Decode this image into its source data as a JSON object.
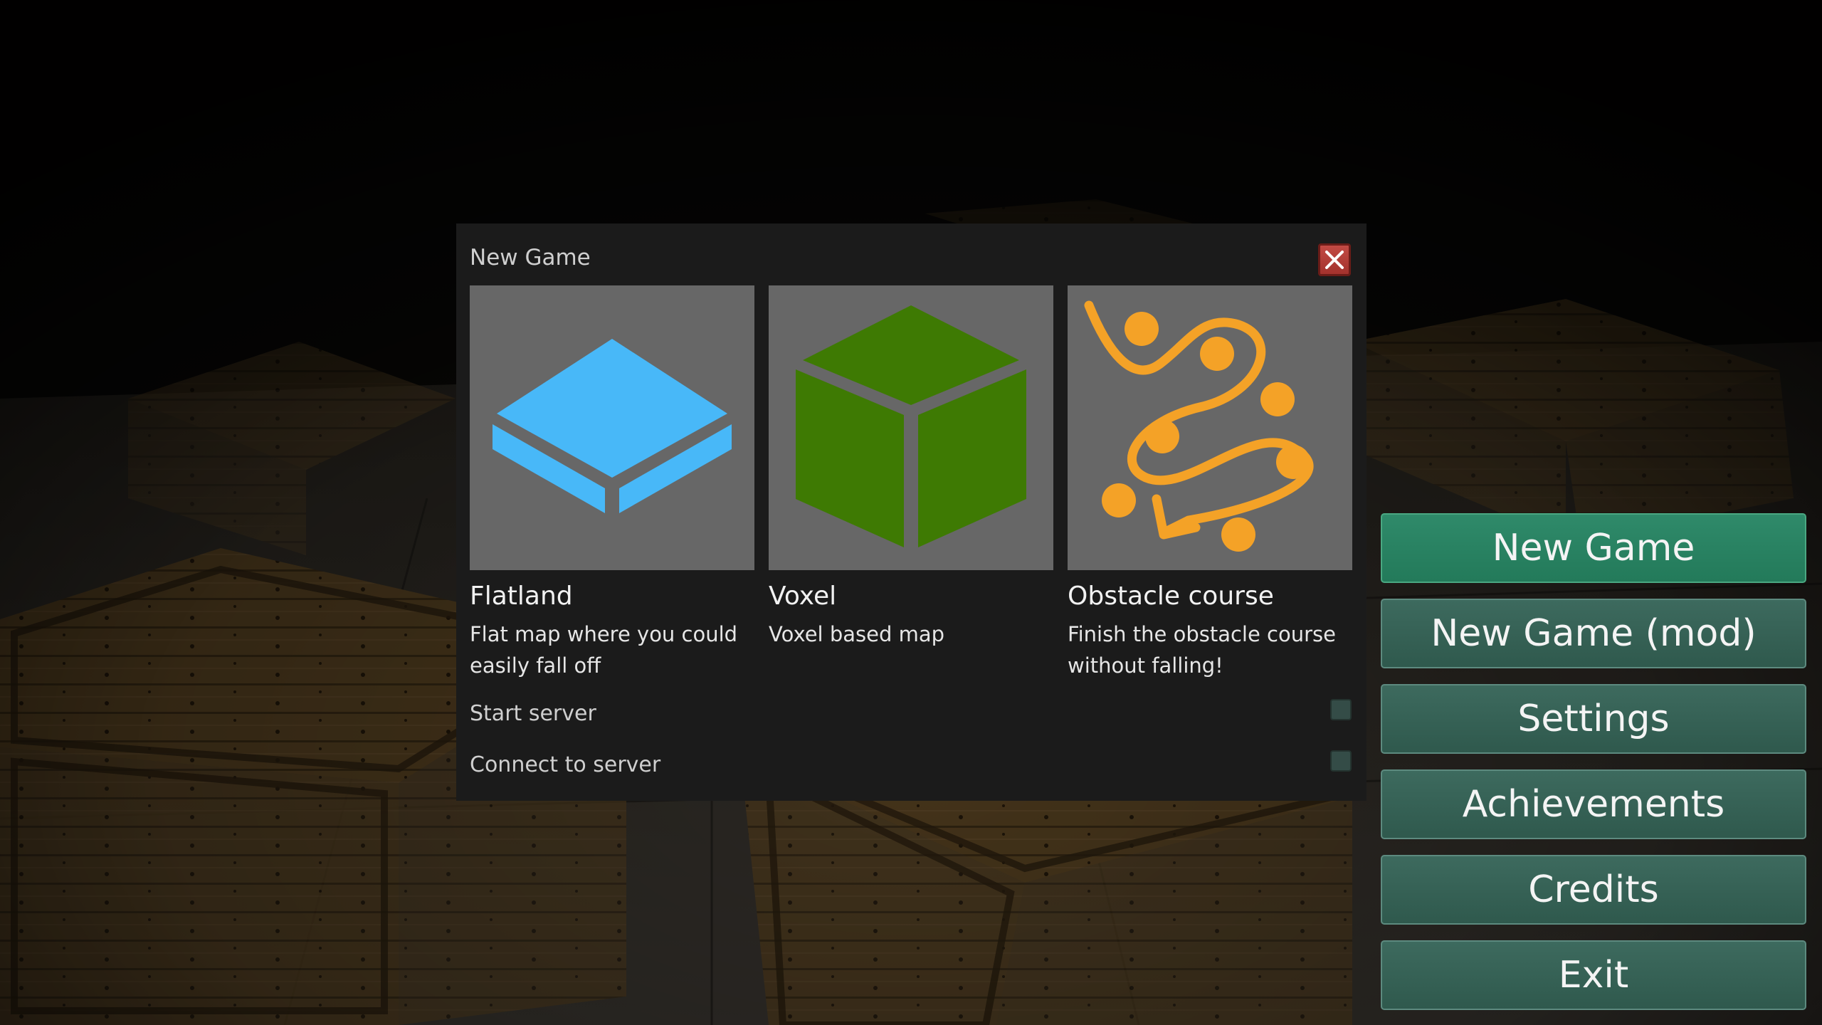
{
  "dialog": {
    "title": "New Game",
    "close_icon": "close-x-icon",
    "cards": [
      {
        "title": "Flatland",
        "description": "Flat map where you could easily fall off",
        "icon": "flat-tile-icon",
        "color": "#48b8f8"
      },
      {
        "title": "Voxel",
        "description": "Voxel based map",
        "icon": "voxel-cube-icon",
        "color": "#3e7a03"
      },
      {
        "title": "Obstacle course",
        "description": "Finish the obstacle course without falling!",
        "icon": "obstacle-path-icon",
        "color": "#f4a227"
      }
    ],
    "options": [
      {
        "label": "Start server",
        "checked": false
      },
      {
        "label": "Connect to server",
        "checked": false
      }
    ]
  },
  "menu": {
    "items": [
      {
        "label": "New Game",
        "active": true
      },
      {
        "label": "New Game (mod)",
        "active": false
      },
      {
        "label": "Settings",
        "active": false
      },
      {
        "label": "Achievements",
        "active": false
      },
      {
        "label": "Credits",
        "active": false
      },
      {
        "label": "Exit",
        "active": false
      }
    ]
  },
  "colors": {
    "dialog_bg": "#1b1b1b",
    "button_bg": "#2f594d",
    "button_active_bg": "#237a5a",
    "close_red": "#b63d37",
    "checkbox": "#344c47"
  }
}
